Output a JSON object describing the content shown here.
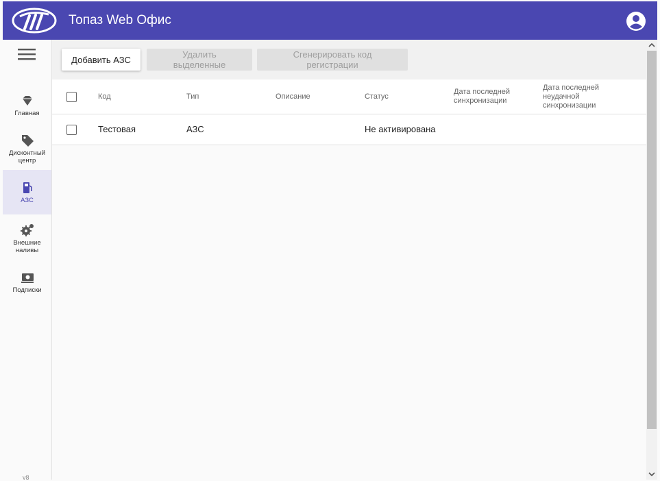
{
  "app": {
    "title": "Топаз Web Офис"
  },
  "sidebar": {
    "items": [
      {
        "label": "Главная",
        "icon": "diamond-icon"
      },
      {
        "label": "Дисконтный центр",
        "icon": "tag-icon"
      },
      {
        "label": "АЗС",
        "icon": "fuel-station-icon",
        "active": true
      },
      {
        "label": "Внешние наливы",
        "icon": "gears-icon"
      },
      {
        "label": "Подписки",
        "icon": "subscription-icon"
      }
    ],
    "version": "v8"
  },
  "toolbar": {
    "add_label": "Добавить АЗС",
    "delete_label": "Удалить выделенные",
    "generate_label": "Сгенерировать код регистрации"
  },
  "table": {
    "headers": [
      "Код",
      "Тип",
      "Описание",
      "Статус",
      "Дата последней синхронизации",
      "Дата последней неудачной синхронизации"
    ],
    "rows": [
      {
        "code": "Тестовая",
        "type": "АЗС",
        "description": "",
        "status": "Не активирована",
        "last_sync": "",
        "last_failed_sync": ""
      }
    ]
  },
  "colors": {
    "accent": "#4a47b1",
    "active_bg": "#e6e5f4"
  }
}
